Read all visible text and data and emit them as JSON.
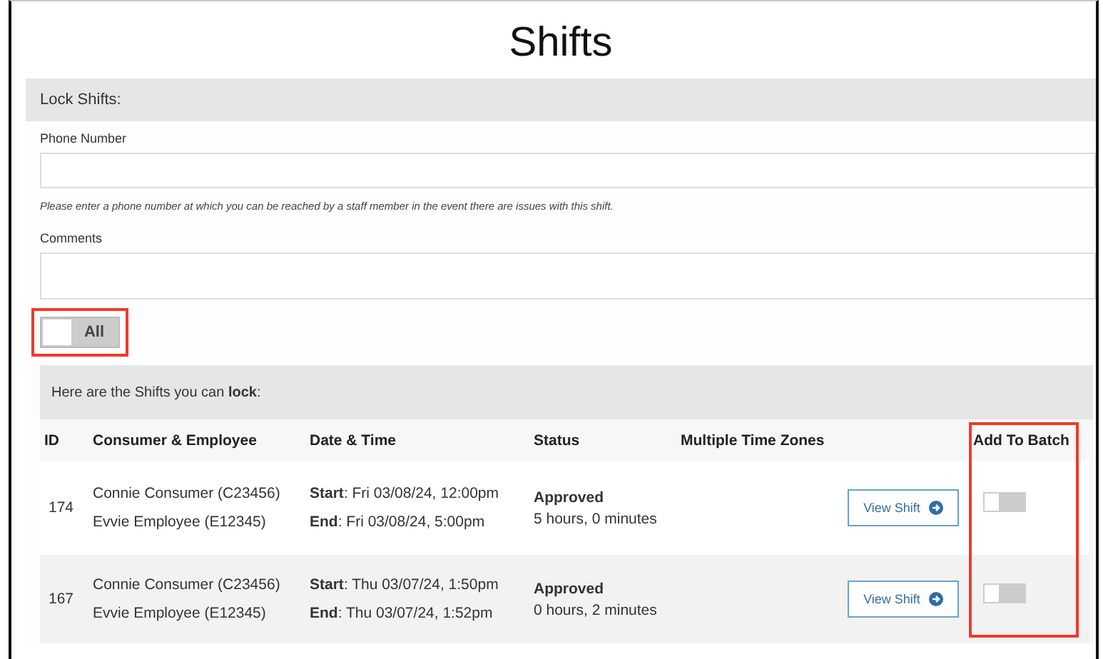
{
  "title": "Shifts",
  "lock_panel": {
    "heading": "Lock Shifts:",
    "phone": {
      "label": "Phone Number",
      "help": "Please enter a phone number at which you can be reached by a staff member in the event there are issues with this shift."
    },
    "comments": {
      "label": "Comments"
    },
    "all_toggle": {
      "label": "All",
      "checked": false,
      "highlighted": true
    }
  },
  "shifts": {
    "intro": "Here are the Shifts you can **lock**:",
    "columns": [
      {
        "label": "ID"
      },
      {
        "label": "Consumer & Employee"
      },
      {
        "label": "Date & Time"
      },
      {
        "label": "Status"
      },
      {
        "label": "Multiple Time Zones"
      },
      {},
      {
        "label": "Add To Batch"
      }
    ],
    "batch_column_highlighted": true,
    "rows": [
      {
        "id": "174",
        "consumer": "Connie Consumer (C23456)",
        "employee": "Evvie Employee (E12345)",
        "start_label": "Start",
        "start": ": Fri 03/08/24, 12:00pm",
        "end_label": "End",
        "end": ": Fri 03/08/24, 5:00pm",
        "status": "Approved",
        "duration": "5 hours, 0 minutes",
        "button": "View Shift",
        "batch": false
      },
      {
        "id": "167",
        "consumer": "Connie Consumer (C23456)",
        "employee": "Evvie Employee (E12345)",
        "start_label": "Start",
        "start": ": Thu 03/07/24, 1:50pm",
        "end_label": "End",
        "end": ": Thu 03/07/24, 1:52pm",
        "status": "Approved",
        "duration": "0 hours, 2 minutes",
        "button": "View Shift",
        "batch": false
      }
    ]
  }
}
